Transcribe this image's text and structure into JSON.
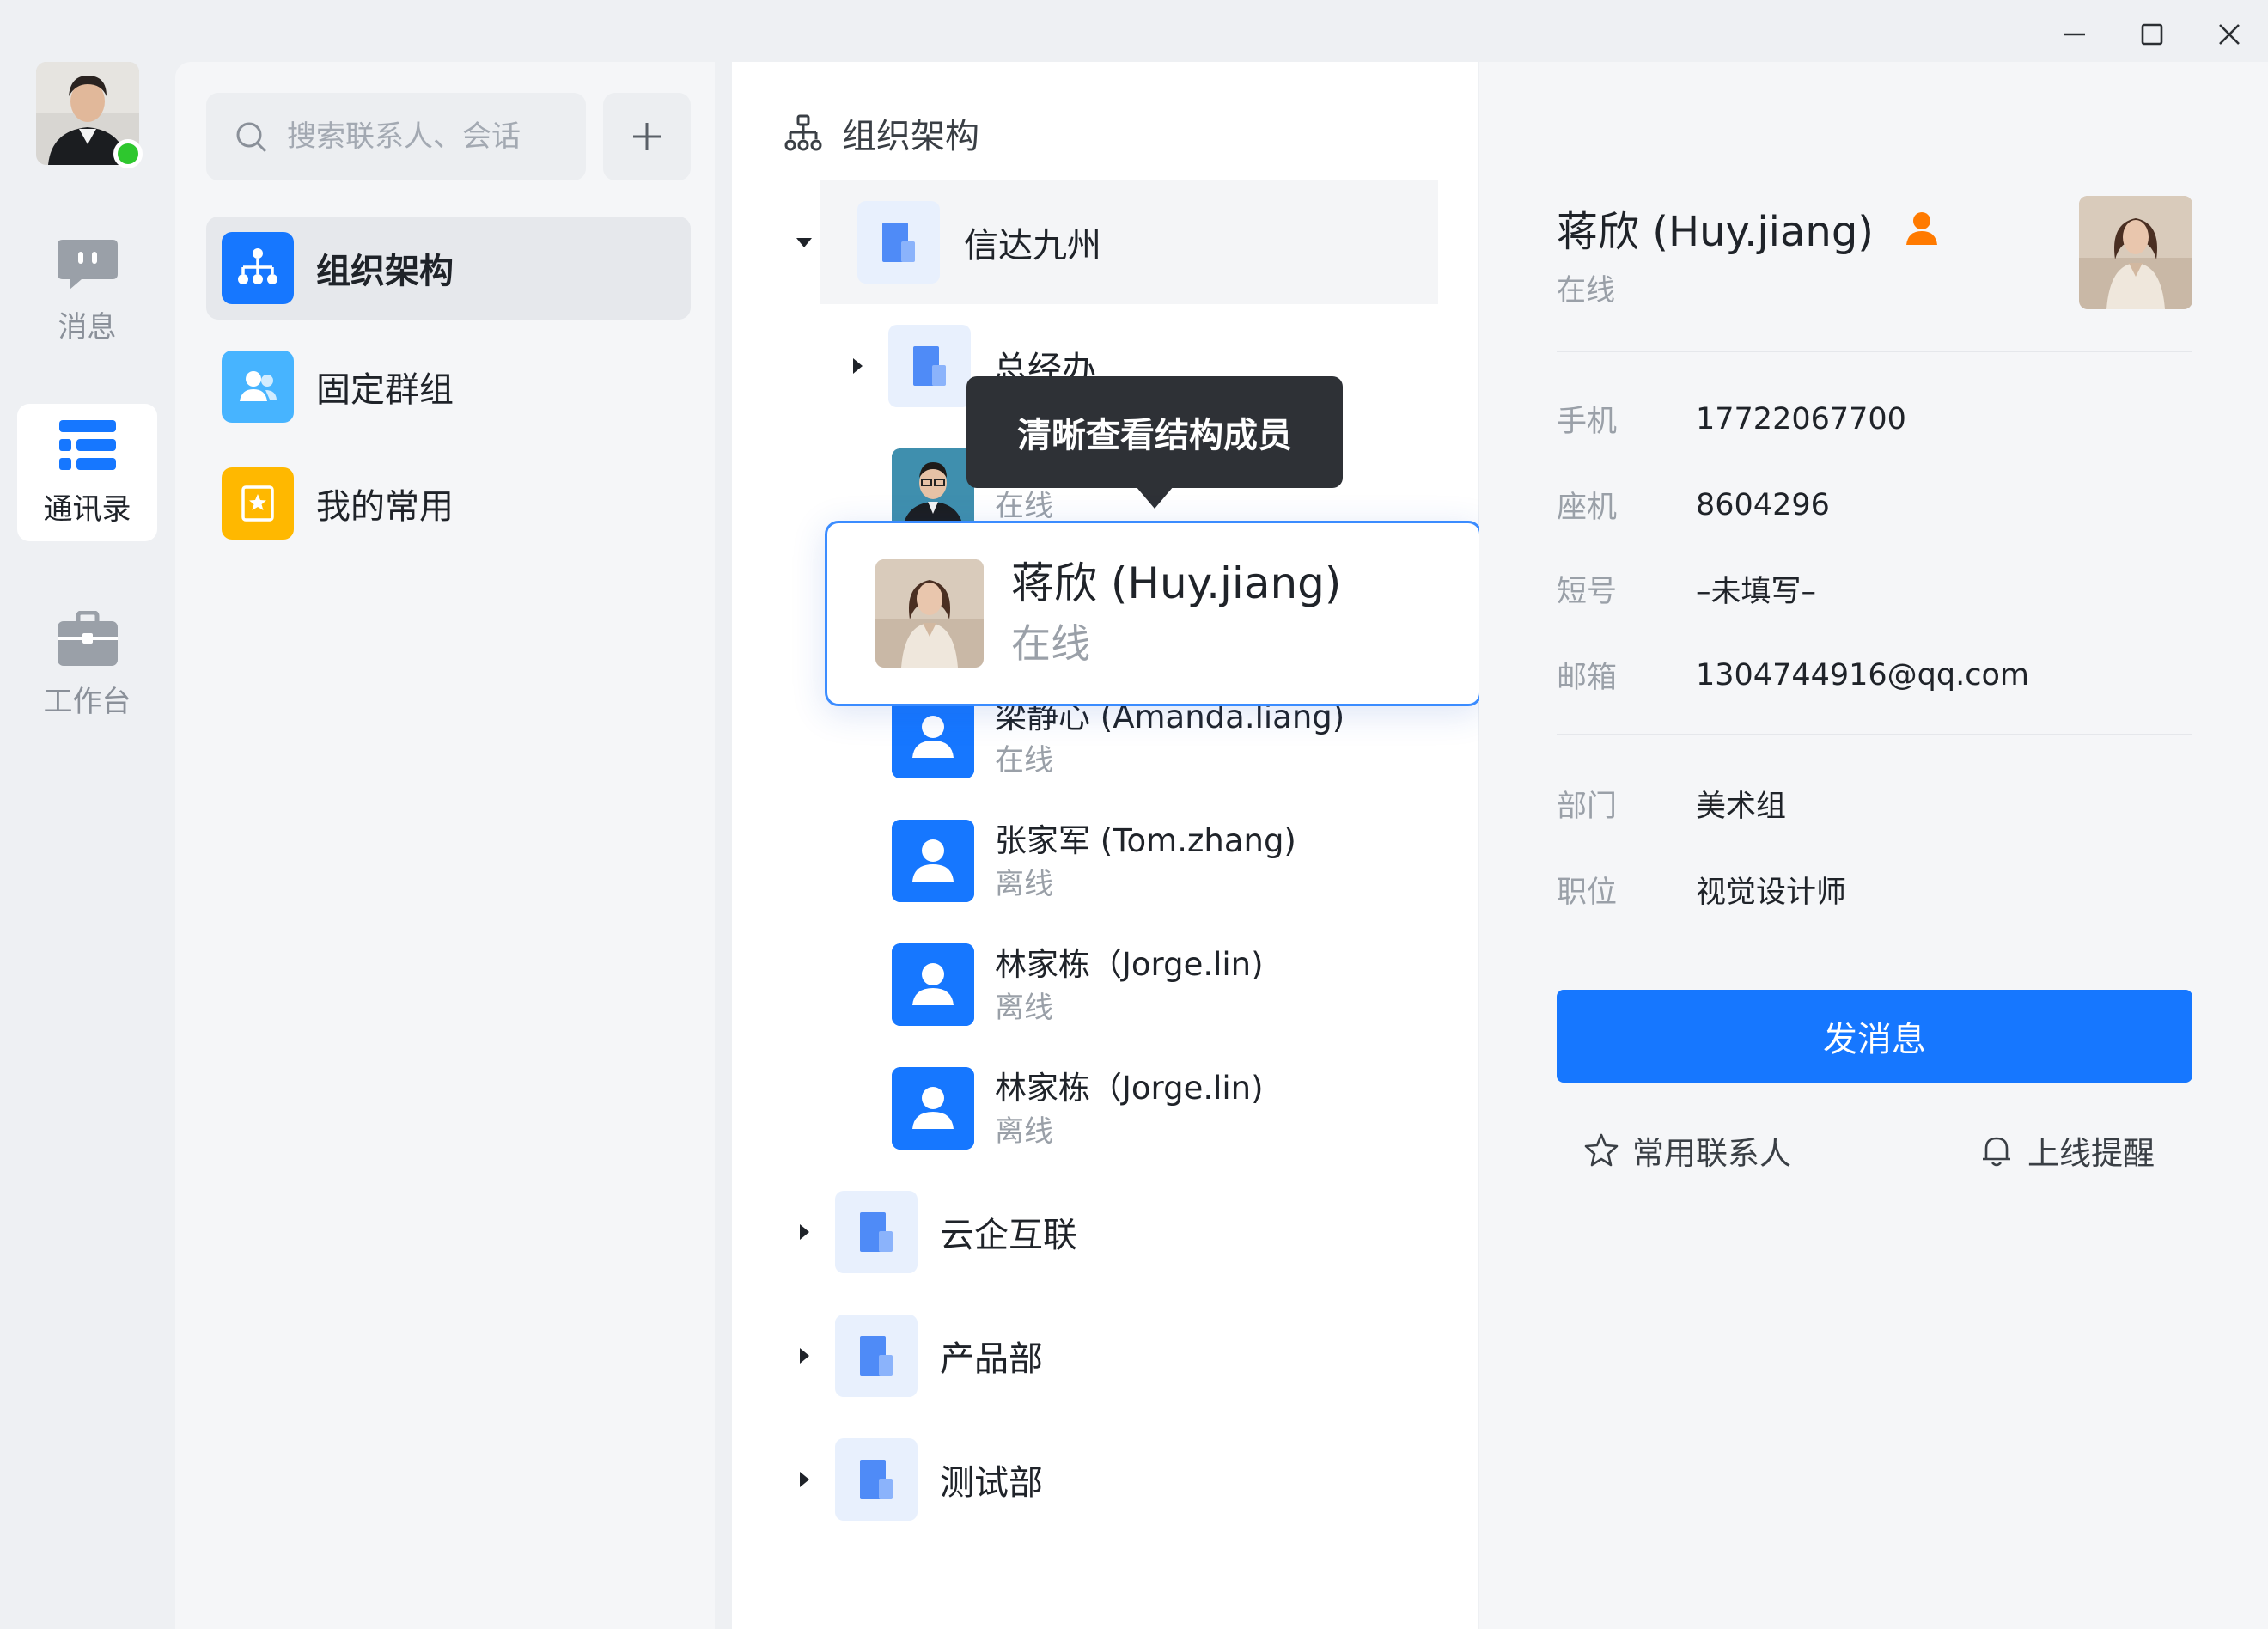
{
  "nav": {
    "items": [
      {
        "label": "消息"
      },
      {
        "label": "通讯录"
      },
      {
        "label": "工作台"
      }
    ]
  },
  "sidebar": {
    "search_placeholder": "搜索联系人、会话",
    "menu": [
      {
        "label": "组织架构"
      },
      {
        "label": "固定群组"
      },
      {
        "label": "我的常用"
      }
    ]
  },
  "tree": {
    "title": "组织架构",
    "root": "信达九州",
    "sub": "总经办",
    "partial_member_status": "在线",
    "members": [
      {
        "name": "梁静心 (Amanda.liang)",
        "status": "在线"
      },
      {
        "name": "张家军 (Tom.zhang)",
        "status": "离线"
      },
      {
        "name": "林家栋（Jorge.lin)",
        "status": "离线"
      },
      {
        "name": "林家栋（Jorge.lin)",
        "status": "离线"
      }
    ],
    "others": [
      "云企互联",
      "产品部",
      "测试部"
    ],
    "tooltip": "清晰查看结构成员",
    "focused": {
      "name": "蒋欣 (Huy.jiang)",
      "status": "在线"
    }
  },
  "detail": {
    "name": "蒋欣 (Huy.jiang)",
    "status": "在线",
    "fields1": [
      {
        "k": "手机",
        "v": "17722067700"
      },
      {
        "k": "座机",
        "v": "8604296"
      },
      {
        "k": "短号",
        "v": "–未填写–"
      },
      {
        "k": "邮箱",
        "v": "1304744916@qq.com"
      }
    ],
    "fields2": [
      {
        "k": "部门",
        "v": "美术组"
      },
      {
        "k": "职位",
        "v": "视觉设计师"
      }
    ],
    "send": "发消息",
    "fav": "常用联系人",
    "remind": "上线提醒"
  },
  "colors": {
    "accent": "#1677ff",
    "online": "#2ec72e",
    "warning": "#ff7a00",
    "menu_yellow": "#ffb800",
    "menu_lightblue": "#47b4ff"
  }
}
